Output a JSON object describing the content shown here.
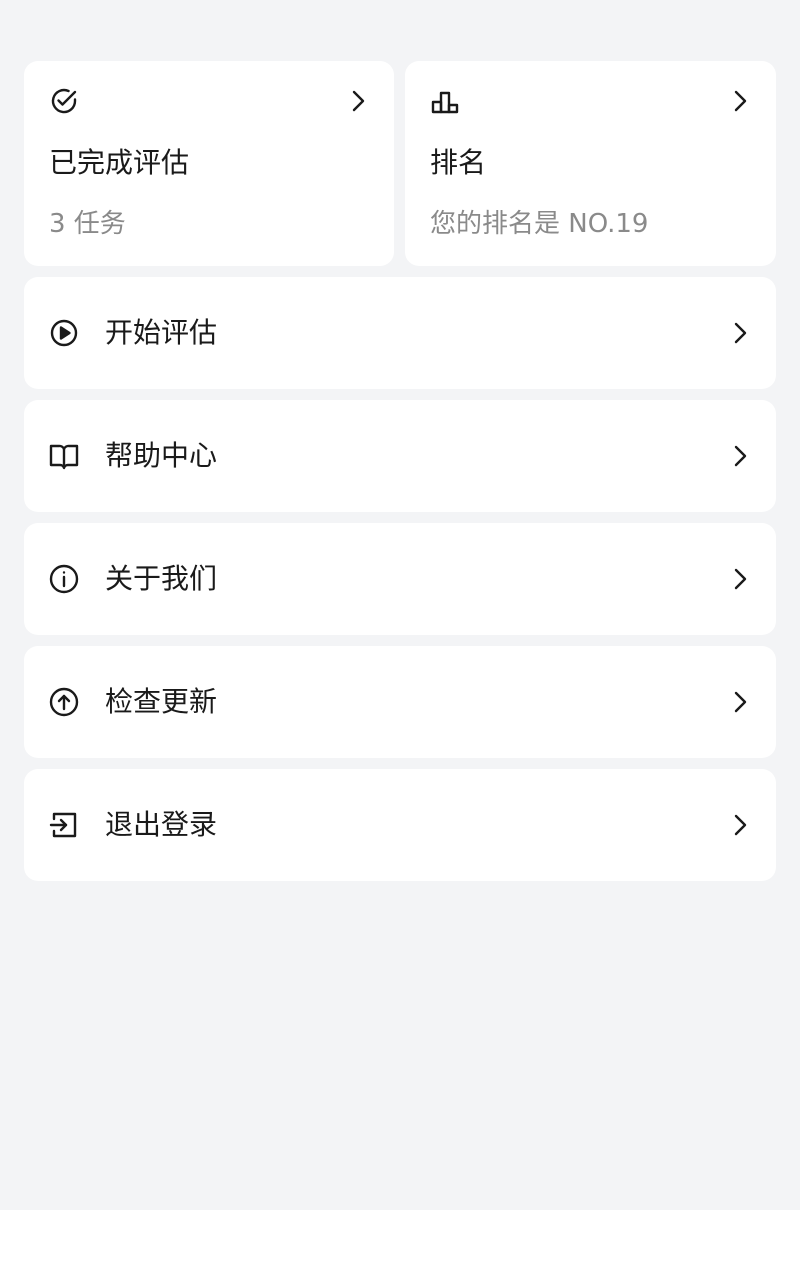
{
  "stats": {
    "completed": {
      "icon": "check-circle-icon",
      "title": "已完成评估",
      "subtitle": "3 任务"
    },
    "ranking": {
      "icon": "bar-chart-icon",
      "title": "排名",
      "subtitle": "您的排名是 NO.19"
    }
  },
  "menu": [
    {
      "icon": "play-circle-icon",
      "label": "开始评估"
    },
    {
      "icon": "book-icon",
      "label": "帮助中心"
    },
    {
      "icon": "info-icon",
      "label": "关于我们"
    },
    {
      "icon": "upload-circle-icon",
      "label": "检查更新"
    },
    {
      "icon": "logout-icon",
      "label": "退出登录"
    }
  ],
  "colors": {
    "page_background": "#f3f4f6",
    "card_background": "#ffffff",
    "primary_text": "#1a1a1a",
    "secondary_text": "#8a8a8a"
  }
}
